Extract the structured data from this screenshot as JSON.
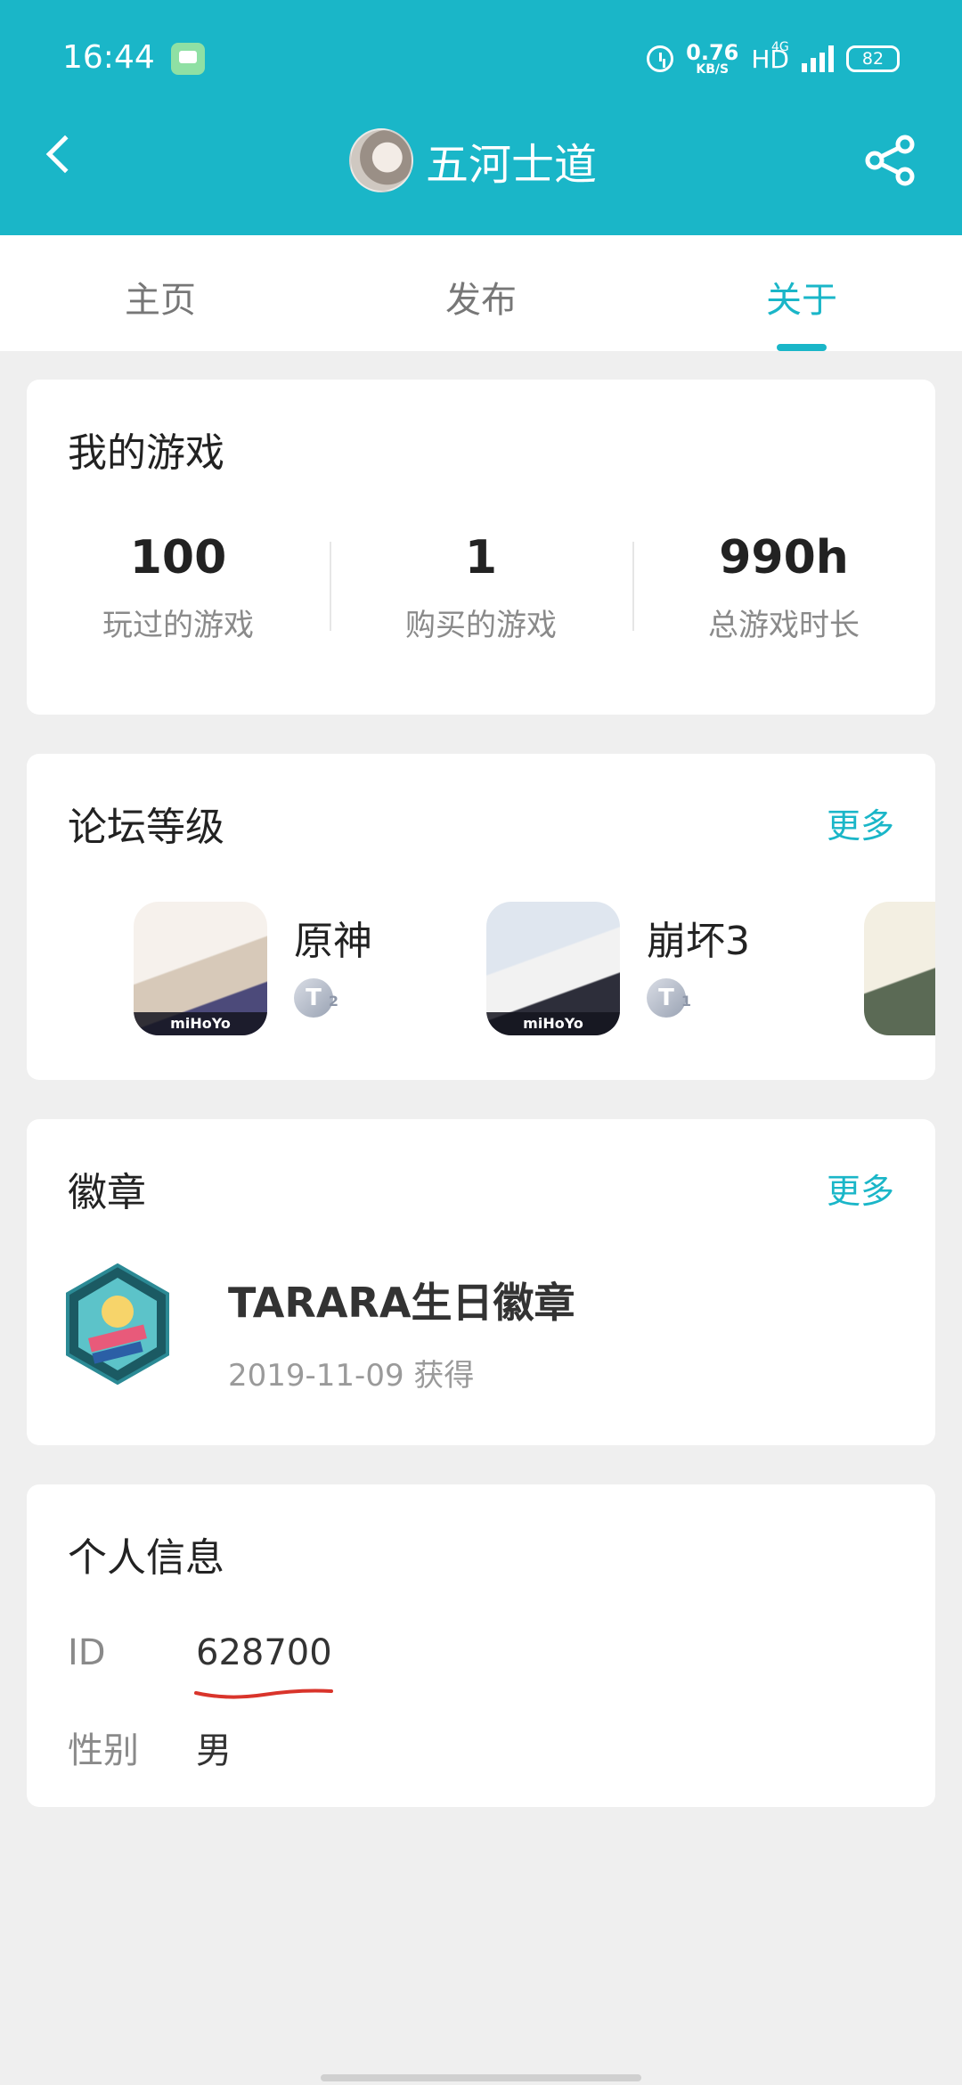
{
  "status_bar": {
    "time": "16:44",
    "net_speed_value": "0.76",
    "net_speed_unit": "KB/S",
    "hd": "HD",
    "network": "4G",
    "battery": "82"
  },
  "header": {
    "title": "五河士道",
    "background_color": "#1ab6c8"
  },
  "tabs": [
    {
      "label": "主页",
      "active": false
    },
    {
      "label": "发布",
      "active": false
    },
    {
      "label": "关于",
      "active": true
    }
  ],
  "my_games": {
    "title": "我的游戏",
    "stats": [
      {
        "value": "100",
        "label": "玩过的游戏"
      },
      {
        "value": "1",
        "label": "购买的游戏"
      },
      {
        "value": "990h",
        "label": "总游戏时长"
      }
    ]
  },
  "forum_level": {
    "title": "论坛等级",
    "more": "更多",
    "items": [
      {
        "name": "原神",
        "level_letter": "T",
        "level_num": "2",
        "brand": "miHoYo"
      },
      {
        "name": "崩坏3",
        "level_letter": "T",
        "level_num": "1",
        "brand": "miHoYo"
      }
    ]
  },
  "badges": {
    "title": "徽章",
    "more": "更多",
    "item": {
      "name": "TARARA生日徽章",
      "date": "2019-11-09 获得"
    }
  },
  "personal_info": {
    "title": "个人信息",
    "id_label": "ID",
    "id_value": "628700",
    "gender_label": "性别",
    "gender_value": "男"
  },
  "accent_color": "#1ab6c8"
}
